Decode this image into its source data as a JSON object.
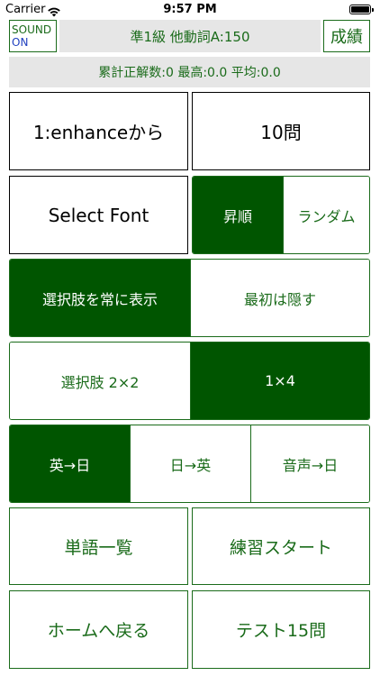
{
  "status_bar": {
    "carrier": "Carrier",
    "time": "9:57 PM"
  },
  "header": {
    "sound_line1": "SOUND",
    "sound_line2": "ON",
    "title": "準1級 他動詞A:150",
    "record_label": "成績"
  },
  "stats": "累計正解数:0 最高:0.0 平均:0.0",
  "range_start": "1:enhanceから",
  "question_count": "10問",
  "select_font": "Select Font",
  "order": {
    "options": [
      "昇順",
      "ランダム"
    ],
    "selected": "昇順"
  },
  "choices_display": {
    "options": [
      "選択肢を常に表示",
      "最初は隠す"
    ],
    "selected": "選択肢を常に表示"
  },
  "choices_layout": {
    "options": [
      "選択肢 2×2",
      "1×4"
    ],
    "selected": "1×4"
  },
  "direction": {
    "options": [
      "英→日",
      "日→英",
      "音声→日"
    ],
    "selected": "英→日"
  },
  "word_list": "単語一覧",
  "practice_start": "練習スタート",
  "back_home": "ホームへ戻る",
  "test_start": "テスト15問",
  "colors": {
    "accent": "#005500",
    "text_green": "#1a6b1a",
    "sound_on_blue": "#1f3fbf",
    "bar_gray": "#e6e6e6"
  }
}
